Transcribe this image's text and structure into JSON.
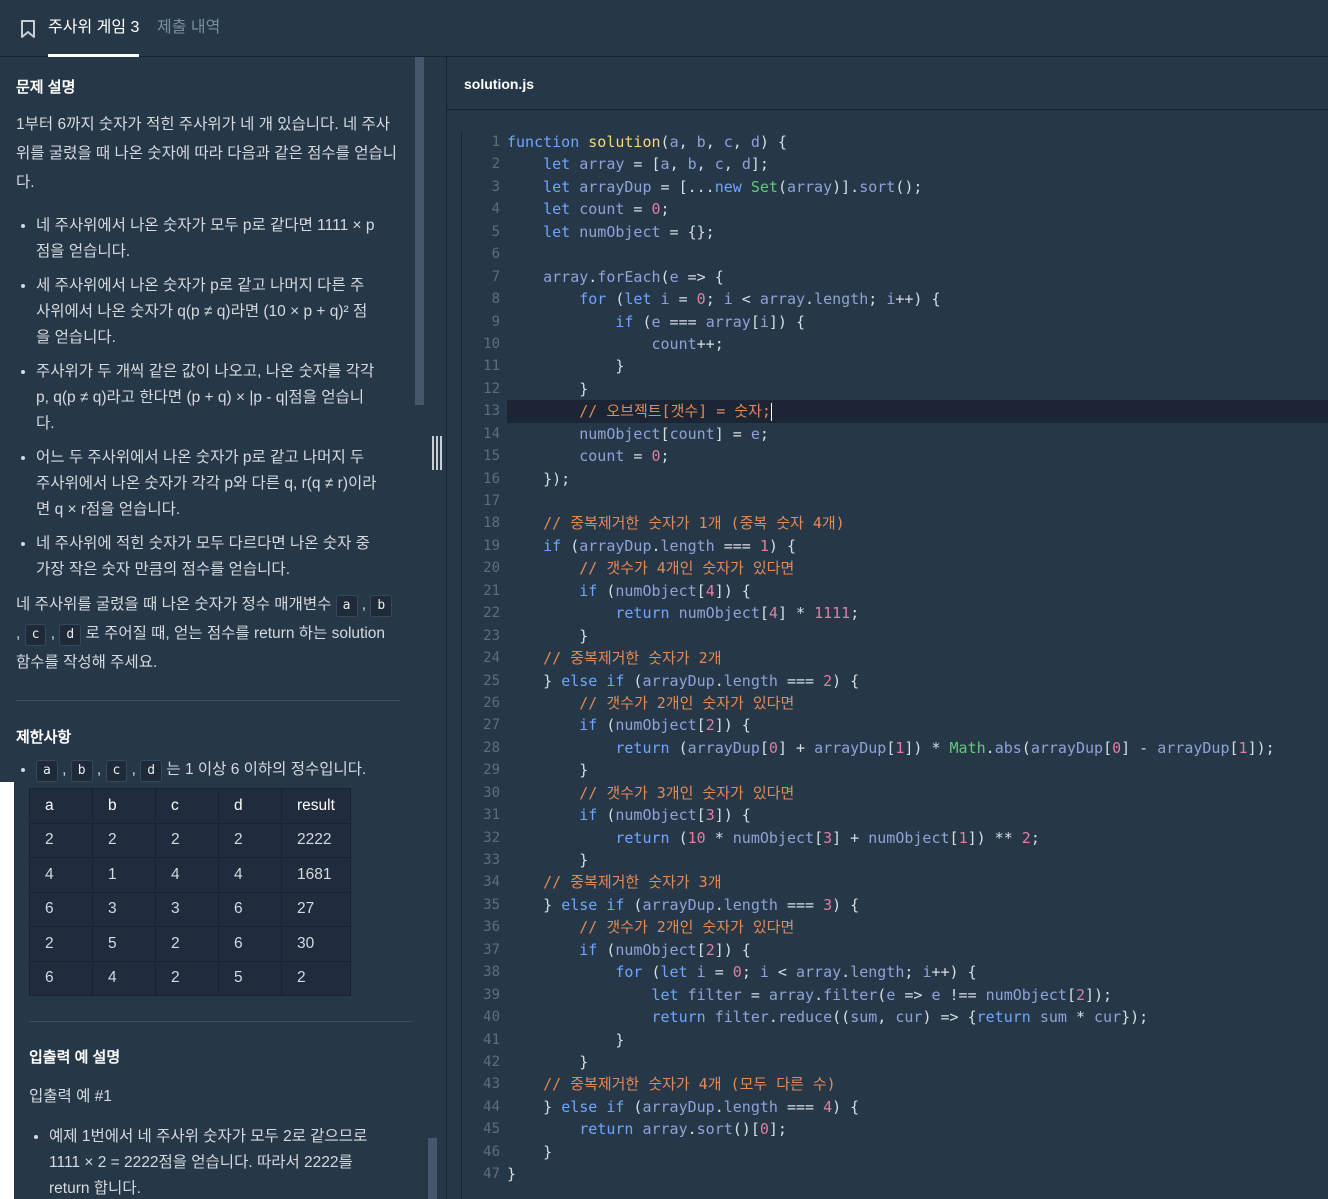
{
  "tabs": {
    "active": "주사위 게임 3",
    "inactive": "제출 내역"
  },
  "problem": {
    "title": "문제 설명",
    "intro": "1부터 6까지 숫자가 적힌 주사위가 네 개 있습니다. 네 주사위를 굴렸을 때 나온 숫자에 따라 다음과 같은 점수를 얻습니다.",
    "rules": [
      "네 주사위에서 나온 숫자가 모두 p로 같다면 1111 × p점을 얻습니다.",
      "세 주사위에서 나온 숫자가 p로 같고 나머지 다른 주사위에서 나온 숫자가 q(p ≠ q)라면 (10 × p + q)² 점을 얻습니다.",
      "주사위가 두 개씩 같은 값이 나오고, 나온 숫자를 각각 p, q(p ≠ q)라고 한다면 (p + q) × |p - q|점을 얻습니다.",
      "어느 두 주사위에서 나온 숫자가 p로 같고 나머지 두 주사위에서 나온 숫자가 각각 p와 다른 q, r(q ≠ r)이라면 q × r점을 얻습니다.",
      "네 주사위에 적힌 숫자가 모두 다르다면 나온 숫자 중 가장 작은 숫자 만큼의 점수를 얻습니다."
    ],
    "closing_1": "네 주사위를 굴렸을 때 나온 숫자가 정수 매개변수",
    "closing_2": "로 주어질 때, 얻는 점수를 return 하는 solution 함수를 작성해 주세요.",
    "params": [
      "a",
      "b",
      "c",
      "d"
    ],
    "constraints_title": "제한사항",
    "constraint_text": "는 1 이상 6 이하의 정수입니다."
  },
  "examples_table": {
    "headers": [
      "a",
      "b",
      "c",
      "d",
      "result"
    ],
    "rows": [
      [
        "2",
        "2",
        "2",
        "2",
        "2222"
      ],
      [
        "4",
        "1",
        "4",
        "4",
        "1681"
      ],
      [
        "6",
        "3",
        "3",
        "6",
        "27"
      ],
      [
        "2",
        "5",
        "2",
        "6",
        "30"
      ],
      [
        "6",
        "4",
        "2",
        "5",
        "2"
      ]
    ]
  },
  "examples_explain": {
    "title": "입출력 예 설명",
    "subtitle": "입출력 예 #1",
    "item": "예제 1번에서 네 주사위 숫자가 모두 2로 같으므로 1111 × 2 = 2222점을 얻습니다. 따라서 2222를 return 합니다."
  },
  "editor": {
    "file_name": "solution.js",
    "active_line": 13,
    "line_numbers": [
      "1",
      "2",
      "3",
      "4",
      "5",
      "6",
      "7",
      "8",
      "9",
      "10",
      "11",
      "12",
      "13",
      "14",
      "15",
      "16",
      "17",
      "18",
      "19",
      "20",
      "21",
      "22",
      "23",
      "24",
      "25",
      "26",
      "27",
      "28",
      "29",
      "30",
      "31",
      "32",
      "33",
      "34",
      "35",
      "36",
      "37",
      "38",
      "39",
      "40",
      "41",
      "42",
      "43",
      "44",
      "45",
      "46",
      "47"
    ],
    "code_lines": [
      "function solution(a, b, c, d) {",
      "    let array = [a, b, c, d];",
      "    let arrayDup = [...new Set(array)].sort();",
      "    let count = 0;",
      "    let numObject = {};",
      "",
      "    array.forEach(e => {",
      "        for (let i = 0; i < array.length; i++) {",
      "            if (e === array[i]) {",
      "                count++;",
      "            }",
      "        }",
      "        // 오브젝트[갯수] = 숫자;",
      "        numObject[count] = e;",
      "        count = 0;",
      "    });",
      "",
      "    // 중복제거한 숫자가 1개 (중복 숫자 4개)",
      "    if (arrayDup.length === 1) {",
      "        // 갯수가 4개인 숫자가 있다면",
      "        if (numObject[4]) {",
      "            return numObject[4] * 1111;",
      "        }",
      "    // 중복제거한 숫자가 2개",
      "    } else if (arrayDup.length === 2) {",
      "        // 갯수가 2개인 숫자가 있다면",
      "        if (numObject[2]) {",
      "            return (arrayDup[0] + arrayDup[1]) * Math.abs(arrayDup[0] - arrayDup[1]);",
      "        }",
      "        // 갯수가 3개인 숫자가 있다면",
      "        if (numObject[3]) {",
      "            return (10 * numObject[3] + numObject[1]) ** 2;",
      "        }",
      "    // 중복제거한 숫자가 3개",
      "    } else if (arrayDup.length === 3) {",
      "        // 갯수가 2개인 숫자가 있다면",
      "        if (numObject[2]) {",
      "            for (let i = 0; i < array.length; i++) {",
      "                let filter = array.filter(e => e !== numObject[2]);",
      "                return filter.reduce((sum, cur) => {return sum * cur});",
      "            }",
      "        }",
      "    // 중복제거한 숫자가 4개 (모두 다른 수)",
      "    } else if (arrayDup.length === 4) {",
      "        return array.sort()[0];",
      "    }",
      "}"
    ]
  },
  "colors": {
    "panel_bg": "#263747",
    "table_bg": "#202b3d",
    "keyword": "#6ea6ff",
    "function_name": "#f7d774",
    "number": "#e07ea3",
    "comment": "#e38a58",
    "class": "#65c97c"
  }
}
